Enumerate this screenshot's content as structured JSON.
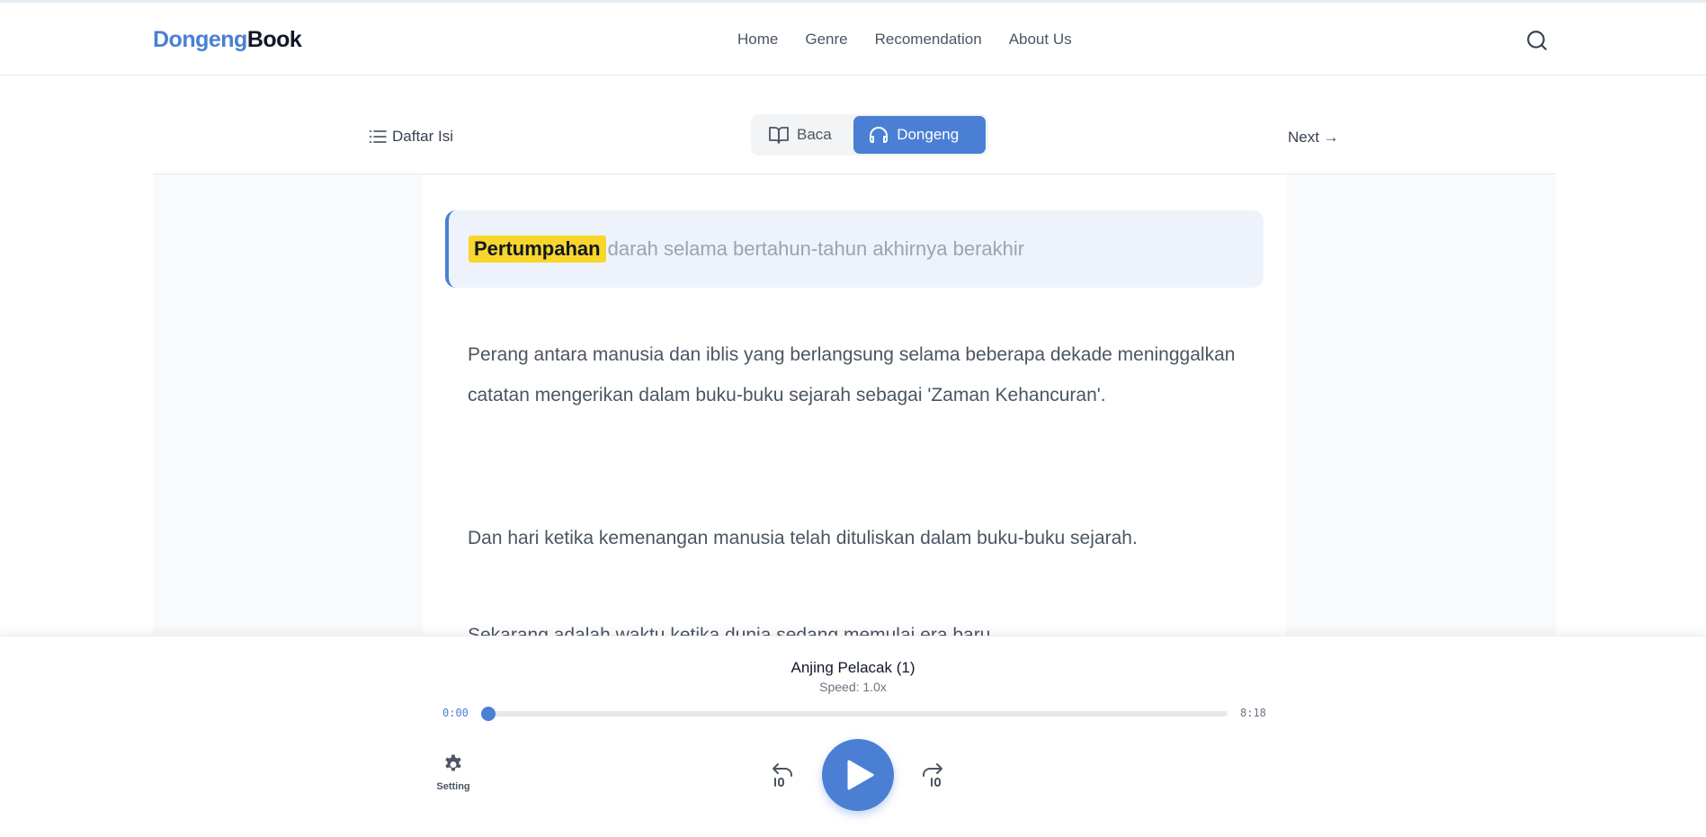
{
  "header": {
    "logo_part1": "Dongeng",
    "logo_part2": "Book",
    "nav": [
      "Home",
      "Genre",
      "Recomendation",
      "About Us"
    ]
  },
  "toolbar": {
    "toc_label": "Daftar Isi",
    "mode_read": "Baca",
    "mode_listen": "Dongeng",
    "next_label": "Next →"
  },
  "content": {
    "quote_highlight": "Pertumpahan",
    "quote_rest": " darah selama bertahun-tahun akhirnya berakhir",
    "paragraphs": [
      "Perang antara manusia dan iblis yang berlangsung selama beberapa dekade meninggalkan catatan mengerikan dalam buku-buku sejarah sebagai 'Zaman Kehancuran'.",
      "Dan hari ketika kemenangan manusia telah dituliskan dalam buku-buku sejarah.",
      "Sekarang adalah waktu ketika dunia sedang memulai era baru."
    ]
  },
  "player": {
    "title": "Anjing Pelacak (1)",
    "speed": "Speed: 1.0x",
    "current_time": "0:00",
    "total_time": "8:18",
    "progress_fraction": 0.0,
    "setting_label": "Setting"
  },
  "colors": {
    "accent": "#4a7fd4",
    "highlight": "#f8d62b"
  }
}
